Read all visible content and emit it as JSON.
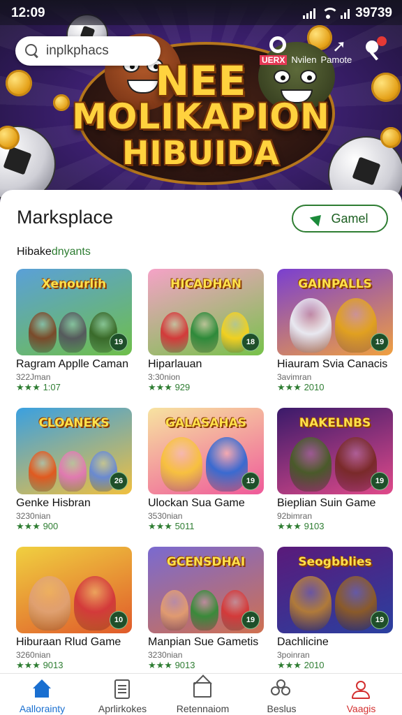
{
  "status_bar": {
    "time": "12:09",
    "battery": "39739"
  },
  "hero": {
    "title_line1": "NEE",
    "title_line2": "MOLIKAPION",
    "title_line3": "HIBUIDA",
    "search_placeholder": "inplkphacs",
    "header_badge": "UERX",
    "header_label1": "Nvilen",
    "header_label2": "Pamote"
  },
  "market": {
    "title": "Marksplace",
    "game_button": "Gamel",
    "section_label_a": "Hibake",
    "section_label_b": "dnyants"
  },
  "games": [
    {
      "art_title": "Xenourlih",
      "title": "Ragram Applle Caman",
      "sub": "322Jman",
      "rating": "★★★ 1:07",
      "badge": "19",
      "bg": "#5aa0d8",
      "bg2": "#6fbf4a",
      "colors": [
        "#7a4a2a",
        "#555a5c",
        "#3a6a2a"
      ]
    },
    {
      "art_title": "HICADHAN",
      "title": "Hiparlauan",
      "sub": "3:30nion",
      "rating": "★★★ 929",
      "badge": "18",
      "bg": "#f5a2c7",
      "bg2": "#77c24a",
      "colors": [
        "#d33a3a",
        "#2e8a3a",
        "#f0d020"
      ]
    },
    {
      "art_title": "GAINPALLS",
      "title": "Hiauram Svia Canacis",
      "sub": "3avimran",
      "rating": "★★★ 2010",
      "badge": "19",
      "bg": "#7a3fd0",
      "bg2": "#f0a040",
      "colors": [
        "#e8e8f0",
        "#e0a020"
      ]
    },
    {
      "art_title": "CLOANEKS",
      "title": "Genke Hisbran",
      "sub": "3230nian",
      "rating": "★★★ 900",
      "badge": "26",
      "bg": "#3aa0e0",
      "bg2": "#f0c040",
      "colors": [
        "#e05a20",
        "#e07ab0",
        "#6a8ad0"
      ]
    },
    {
      "art_title": "GALASAHAS",
      "title": "Ulockan Sua Game",
      "sub": "3530nian",
      "rating": "★★★ 5011",
      "badge": "19",
      "bg": "#f7e3a0",
      "bg2": "#ef5a9a",
      "colors": [
        "#f7c040",
        "#3a6ad0"
      ]
    },
    {
      "art_title": "NAKELNBS",
      "title": "Bieplian Suin Game",
      "sub": "92bimran",
      "rating": "★★★ 9103",
      "badge": "19",
      "bg": "#3a1a6a",
      "bg2": "#e04a8a",
      "colors": [
        "#4a5a2a",
        "#7a2a2a"
      ]
    },
    {
      "art_title": "",
      "title": "Hiburaan Rlud Game",
      "sub": "3260nian",
      "rating": "★★★ 9013",
      "badge": "10",
      "bg": "#f0d040",
      "bg2": "#e05a2a",
      "colors": [
        "#e0a070",
        "#d33a3a"
      ]
    },
    {
      "art_title": "GCENSDHAI",
      "title": "Manpian Sue Gametis",
      "sub": "3230nian",
      "rating": "★★★ 9013",
      "badge": "19",
      "bg": "#7a6ad0",
      "bg2": "#d07050",
      "colors": [
        "#e09a70",
        "#3a8a3a",
        "#d33a3a"
      ]
    },
    {
      "art_title": "Seogbblies",
      "title": "Dachlicine",
      "sub": "3poinran",
      "rating": "★★★ 2010",
      "badge": "19",
      "bg": "#5a1a7a",
      "bg2": "#2a40a0",
      "colors": [
        "#b07a3a",
        "#8a5a2a"
      ]
    }
  ],
  "nav": [
    {
      "label": "Aallorainty"
    },
    {
      "label": "Aprlirkokes"
    },
    {
      "label": "Retennaiom"
    },
    {
      "label": "Beslus"
    },
    {
      "label": "Vaagis"
    }
  ],
  "accent_colors": {
    "green": "#2e7d32",
    "blue": "#1a6fd0",
    "red": "#d32f2f"
  }
}
